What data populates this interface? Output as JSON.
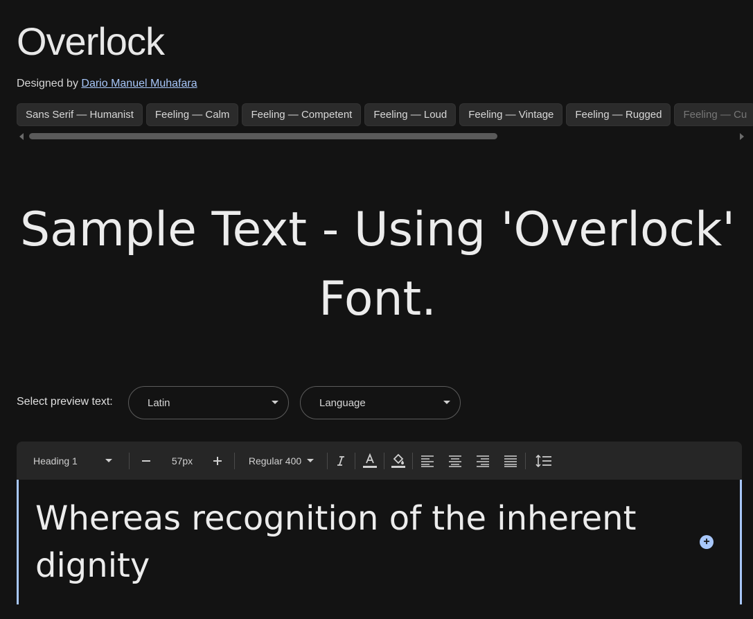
{
  "font": {
    "title": "Overlock",
    "designed_by_prefix": "Designed by ",
    "designer_name": "Dario Manuel Muhafara"
  },
  "tags": [
    "Sans Serif — Humanist",
    "Feeling — Calm",
    "Feeling — Competent",
    "Feeling — Loud",
    "Feeling — Vintage",
    "Feeling — Rugged",
    "Feeling — Cu"
  ],
  "sample_text": "Sample Text - Using 'Overlock' Font.",
  "preview": {
    "label": "Select preview text:",
    "script_value": "Latin",
    "language_value": "Language"
  },
  "toolbar": {
    "style_value": "Heading 1",
    "decrease_icon": "minus-icon",
    "size_value": "57px",
    "increase_icon": "plus-icon",
    "weight_value": "Regular 400",
    "icons": [
      "italic-icon",
      "text-color-icon",
      "highlight-color-icon",
      "align-left-icon",
      "align-center-icon",
      "align-right-icon",
      "align-justify-icon",
      "line-spacing-icon"
    ]
  },
  "editor": {
    "text": "Whereas recognition of the inherent dignity",
    "add_icon": "add-circle-icon"
  },
  "colors": {
    "background": "#131313",
    "accent": "#a8c7fa",
    "chip": "#2b2b2b",
    "toolbar": "#262626"
  }
}
